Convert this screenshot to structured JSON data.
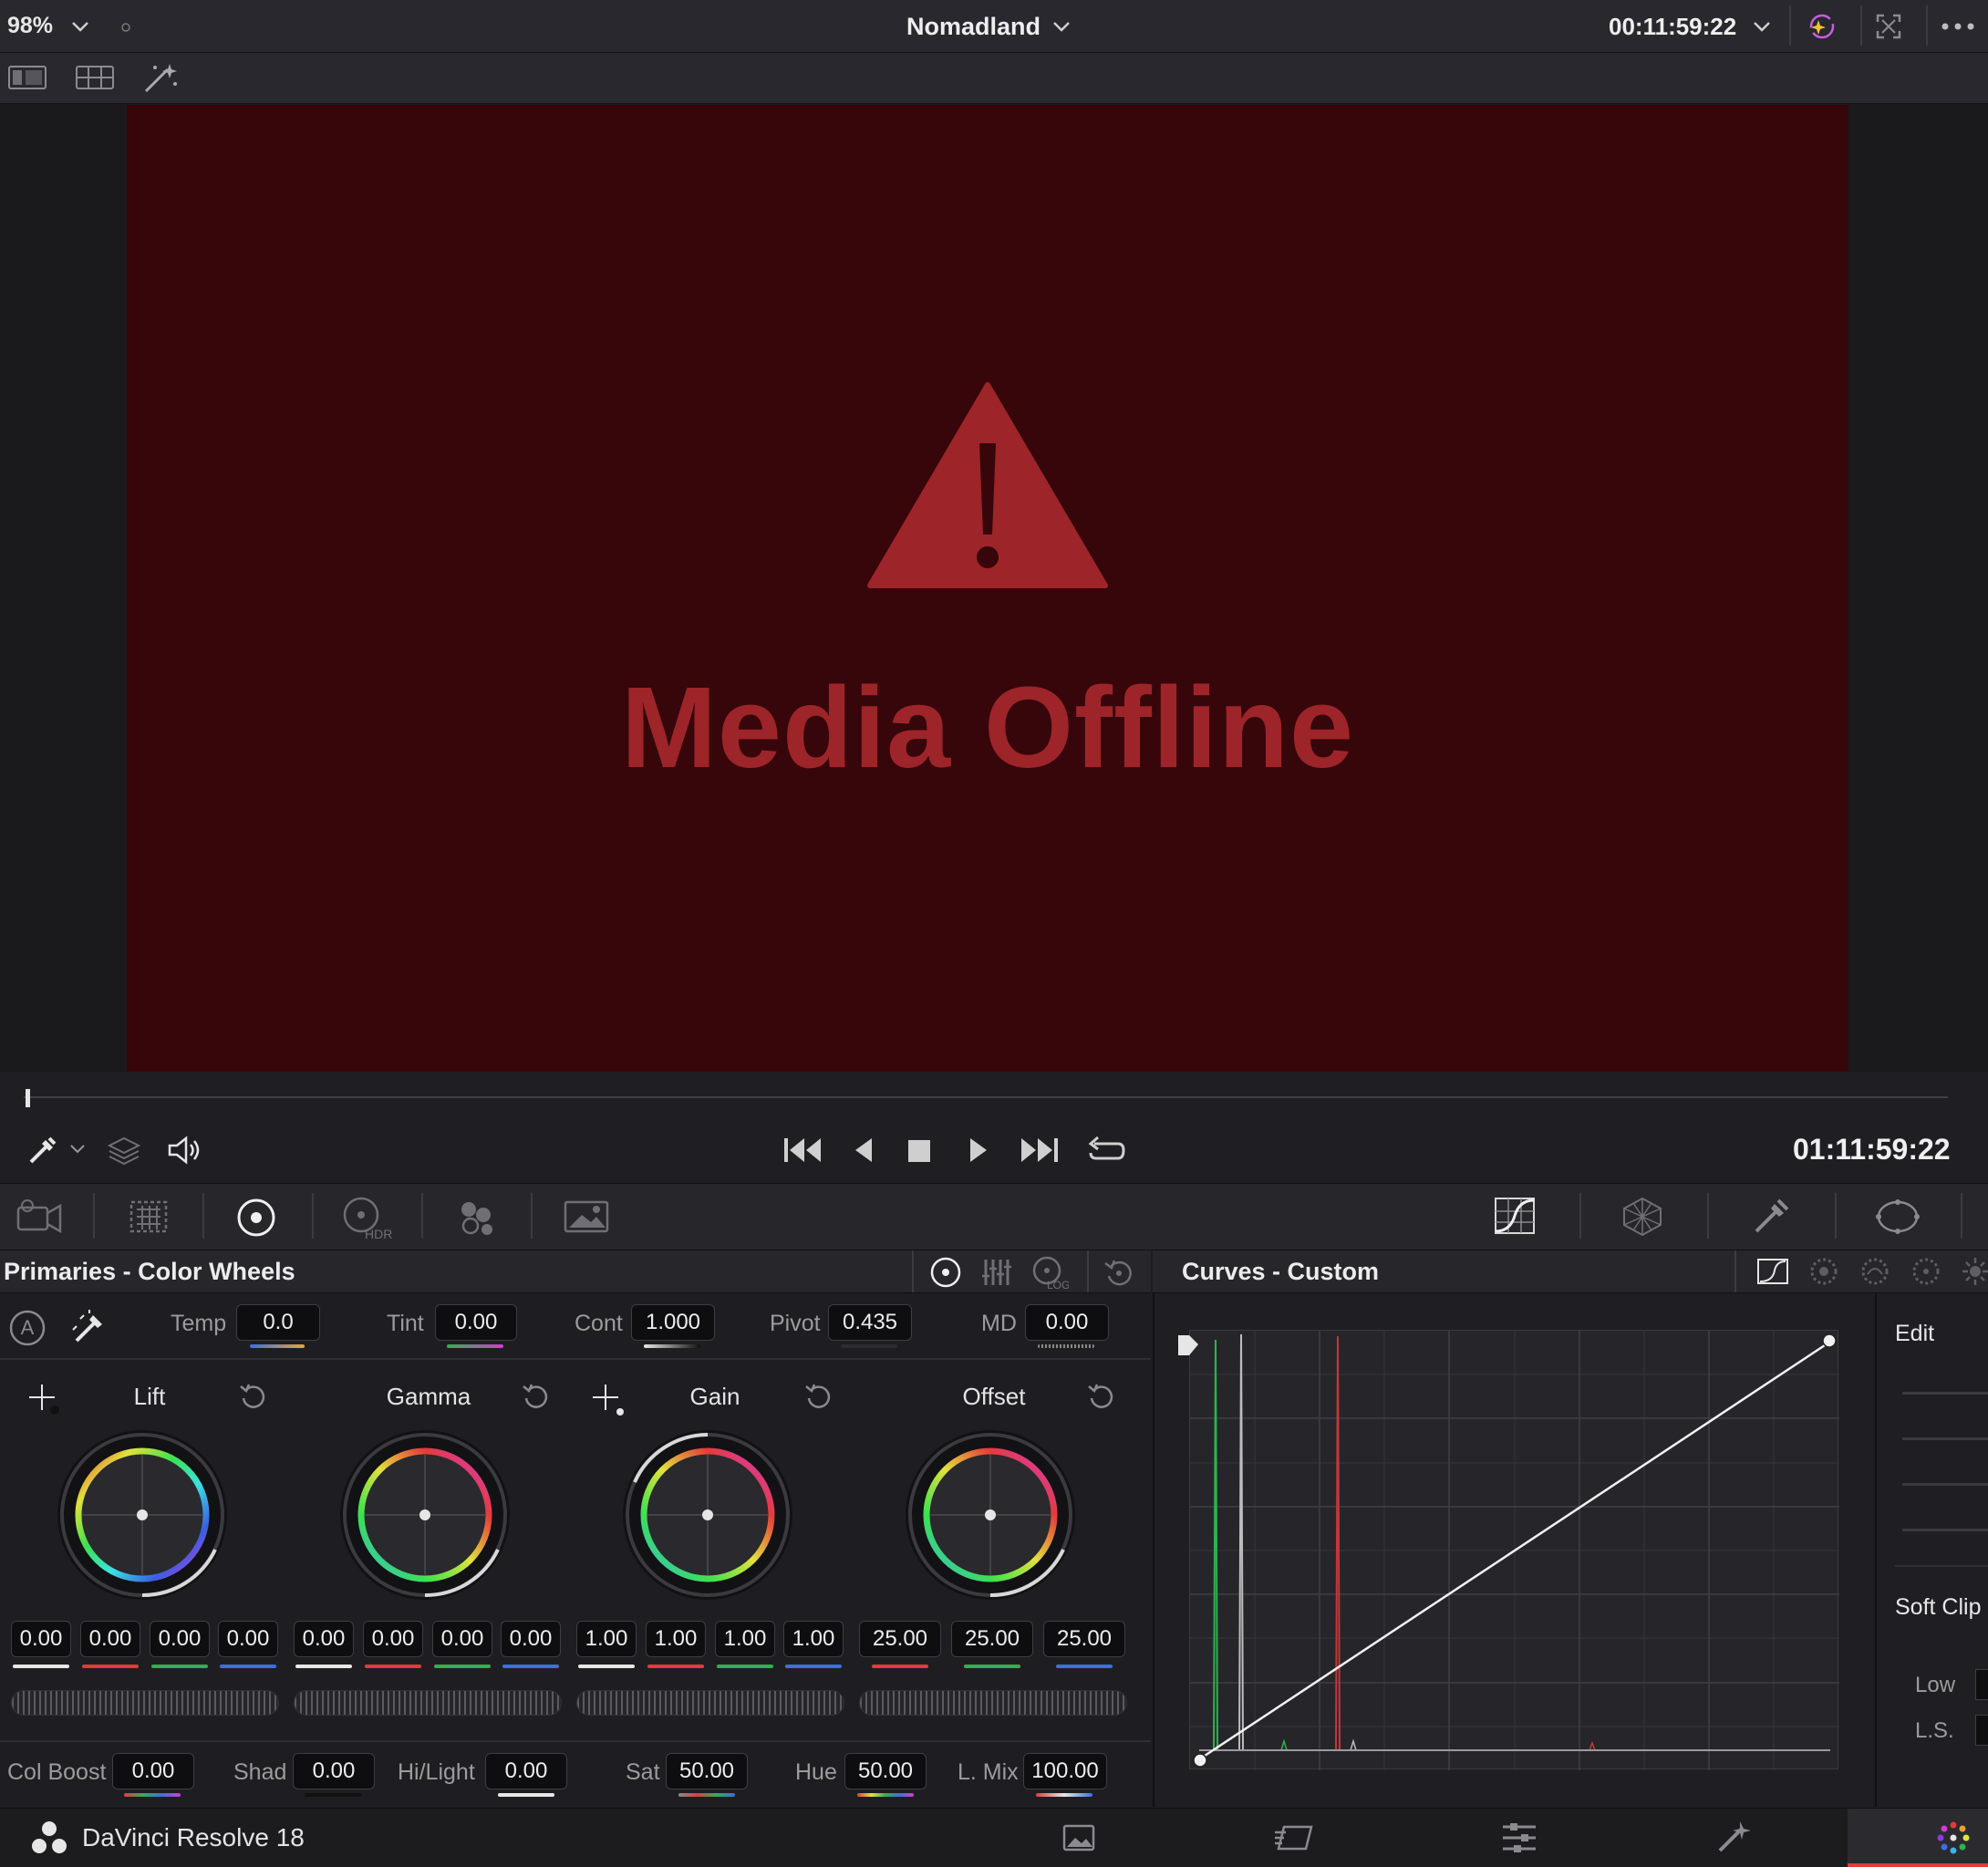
{
  "topbar": {
    "zoom": "98%",
    "project_title": "Nomadland",
    "timecode": "00:11:59:22"
  },
  "viewer": {
    "offline_text": "Media Offline",
    "frame_color": "#36060a",
    "warning_color": "#9d2428"
  },
  "transport": {
    "timecode": "01:11:59:22"
  },
  "primaries": {
    "title": "Primaries - Color Wheels",
    "auto_label": "A",
    "temp_label": "Temp",
    "temp": "0.0",
    "tint_label": "Tint",
    "tint": "0.00",
    "cont_label": "Cont",
    "cont": "1.000",
    "pivot_label": "Pivot",
    "pivot": "0.435",
    "md_label": "MD",
    "md": "0.00",
    "wheels": [
      {
        "label": "Lift",
        "values": [
          "0.00",
          "0.00",
          "0.00",
          "0.00"
        ]
      },
      {
        "label": "Gamma",
        "values": [
          "0.00",
          "0.00",
          "0.00",
          "0.00"
        ]
      },
      {
        "label": "Gain",
        "values": [
          "1.00",
          "1.00",
          "1.00",
          "1.00"
        ]
      },
      {
        "label": "Offset",
        "values": [
          "25.00",
          "25.00",
          "25.00"
        ]
      }
    ],
    "colboost_label": "Col Boost",
    "colboost": "0.00",
    "shad_label": "Shad",
    "shad": "0.00",
    "hilight_label": "Hi/Light",
    "hilight": "0.00",
    "sat_label": "Sat",
    "sat": "50.00",
    "hue_label": "Hue",
    "hue": "50.00",
    "lmix_label": "L. Mix",
    "lmix": "100.00"
  },
  "curves": {
    "title": "Curves - Custom",
    "edit_label": "Edit",
    "soft_clip_label": "Soft Clip",
    "low_label": "Low",
    "ls_label": "L.S."
  },
  "footer": {
    "app_name": "DaVinci Resolve 18"
  },
  "colors": {
    "red": "#e23b3b",
    "green": "#2fb14f",
    "blue": "#3b6fe2",
    "white": "#e8e8e8"
  }
}
